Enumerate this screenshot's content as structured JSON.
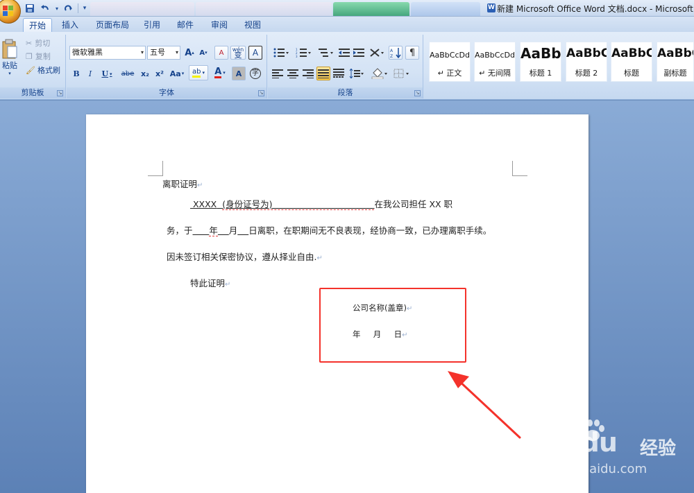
{
  "window": {
    "title": "新建 Microsoft Office Word 文档.docx - Microsoft Wo"
  },
  "quick_access": {
    "icons": [
      "save-icon",
      "undo-icon",
      "redo-icon",
      "customize-icon"
    ]
  },
  "ribbon_tabs": [
    "开始",
    "插入",
    "页面布局",
    "引用",
    "邮件",
    "审阅",
    "视图"
  ],
  "active_tab": "开始",
  "clipboard": {
    "paste_label": "粘贴",
    "cut_label": "剪切",
    "copy_label": "复制",
    "format_painter_label": "格式刷",
    "group_label": "剪贴板"
  },
  "font": {
    "font_name": "微软雅黑",
    "font_size": "五号",
    "group_label": "字体",
    "bold": "B",
    "italic": "I",
    "underline": "U",
    "strike": "abe",
    "subscript": "x₂",
    "superscript": "x²",
    "change_case": "Aa",
    "grow": "A",
    "shrink": "A",
    "clear": "A",
    "phonetic": "wén",
    "char_border": "A",
    "char_shading": "A",
    "enclose": "字",
    "highlight_color": "#f6f200",
    "font_color": "#e0201a"
  },
  "paragraph": {
    "group_label": "段落"
  },
  "styles": {
    "items": [
      {
        "sample": "AaBbCcDd",
        "name": "↵ 正文"
      },
      {
        "sample": "AaBbCcDd",
        "name": "↵ 无间隔"
      },
      {
        "sample": "AaBb",
        "name": "标题 1"
      },
      {
        "sample": "AaBbC",
        "name": "标题 2"
      },
      {
        "sample": "AaBbC",
        "name": "标题"
      },
      {
        "sample": "AaBbC",
        "name": "副标题"
      }
    ]
  },
  "document": {
    "title": "离职证明",
    "line1_name": "XXXX",
    "line1_id": "(身份证号为)",
    "line1_rest": "在我公司担任  XX  职",
    "line2": "务，于",
    "line2_year": "年",
    "line2_month": "月",
    "line2_day": "日离职，在职期间无不良表现，经协商一致，已办理离职手续。",
    "line3": "因未签订相关保密协议，遵从择业自由.",
    "line4": "特此证明",
    "company": "公司名称(盖章)",
    "date_year": "年",
    "date_month": "月",
    "date_day": "日",
    "paragraph_mark": "↵"
  },
  "annotation": {
    "box_color": "#f4322b",
    "arrow_color": "#f4322b"
  },
  "watermark": {
    "brand": "Baidu",
    "brand_cn": "经验",
    "url": "jingyan.baidu.com"
  }
}
